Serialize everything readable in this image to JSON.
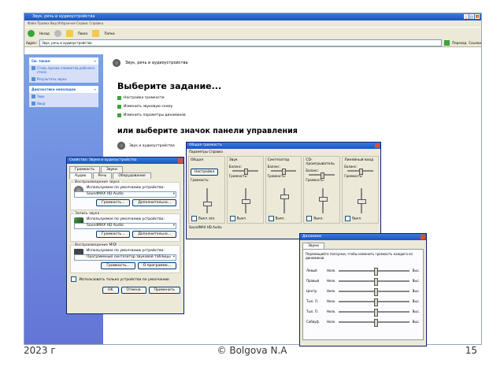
{
  "explorer": {
    "title": "Звук, речь и аудиоустройства",
    "menu": "Файл   Правка   Вид   Избранное   Сервис   Справка",
    "toolbar": {
      "back": "Назад",
      "search": "Поиск",
      "folders": "Папки"
    },
    "address_label": "Адрес:",
    "address_value": "Звук, речь и аудиоустройства",
    "go_label": "Переход",
    "links_label": "Ссылки"
  },
  "left_pane": {
    "boxes": [
      {
        "title": "См. также",
        "items": [
          "Стиль прочих элементов рабочего стола",
          "Результаты звука"
        ]
      },
      {
        "title": "Диагностика неполадок",
        "items": [
          "Звук",
          "Ввод"
        ]
      }
    ]
  },
  "main": {
    "category": "Звук, речь и аудиоустройства",
    "pick_task": "Выберите задание...",
    "tasks": [
      "Настройка громкости",
      "Изменить звуковую схему",
      "Изменить параметры динамиков"
    ],
    "or_pick": "или выберите значок панели управления",
    "icons": [
      "Звук и аудиоустройства"
    ]
  },
  "dialog_props": {
    "title": "Свойства: Звуки и аудиоустройства",
    "tabs_row1": [
      "Громкость",
      "Звуки"
    ],
    "tabs_row2": [
      "Аудио",
      "Речь",
      "Оборудование"
    ],
    "groups": [
      {
        "title": "Воспроизведение звука",
        "label": "Используемое по умолчанию устройство:",
        "value": "SoundMAX HD Audio",
        "buttons": [
          "Громкость...",
          "Дополнительно..."
        ]
      },
      {
        "title": "Запись звука",
        "label": "Используемое по умолчанию устройство:",
        "value": "SoundMAX HD Audio",
        "buttons": [
          "Громкость...",
          "Дополнительно..."
        ]
      },
      {
        "title": "Воспроизведение MIDI",
        "label": "Используемое по умолчанию устройство:",
        "value": "Программный синтезатор звуковой таблицы",
        "buttons": [
          "Громкость...",
          "О программе..."
        ]
      }
    ],
    "checkbox": "Использовать только устройства по умолчанию",
    "footer_buttons": [
      "OK",
      "Отмена",
      "Применить"
    ]
  },
  "dialog_mixer": {
    "title": "Общая громкость",
    "menu": "Параметры   Справка",
    "columns": [
      {
        "title": "Общая",
        "balance": "Баланс:",
        "volume": "Громкость:",
        "mute": "Выкл. все",
        "extra": "Настройка"
      },
      {
        "title": "Звук",
        "balance": "Баланс:",
        "volume": "Громкость:",
        "mute": "Выкл."
      },
      {
        "title": "Синтезатор",
        "balance": "Баланс:",
        "volume": "Громкость:",
        "mute": "Выкл."
      },
      {
        "title": "CD-проигрыватель",
        "balance": "Баланс:",
        "volume": "Громкость:",
        "mute": "Выкл."
      },
      {
        "title": "Линейный вход",
        "balance": "Баланс:",
        "volume": "Громкость:",
        "mute": "Выкл."
      }
    ],
    "thumb_levels": [
      0.4,
      0.5,
      0.7,
      0.6,
      0.5
    ],
    "status": "SoundMAX HD Audio"
  },
  "dialog_speakers": {
    "title": "Динамики",
    "tab": "Звуки",
    "text": "Перемещайте ползунки, чтобы изменить громкость каждого из динамиков",
    "rows": [
      {
        "label": "Левый",
        "low": "Низк.",
        "high": "Выс.",
        "level": 0.5
      },
      {
        "label": "Правый",
        "low": "Низк.",
        "high": "Выс.",
        "level": 0.5
      },
      {
        "label": "Центр.",
        "low": "Низк.",
        "high": "Выс.",
        "level": 0.5
      },
      {
        "label": "Тыл. Л.",
        "low": "Низк.",
        "high": "Выс.",
        "level": 0.5
      },
      {
        "label": "Тыл. П.",
        "low": "Низк.",
        "high": "Выс.",
        "level": 0.5
      },
      {
        "label": "Сабвуф.",
        "low": "Низк.",
        "high": "Выс.",
        "level": 0.5
      }
    ]
  },
  "footer": {
    "year": "2023 г",
    "author": "© Bolgova N.A",
    "page": "15"
  }
}
